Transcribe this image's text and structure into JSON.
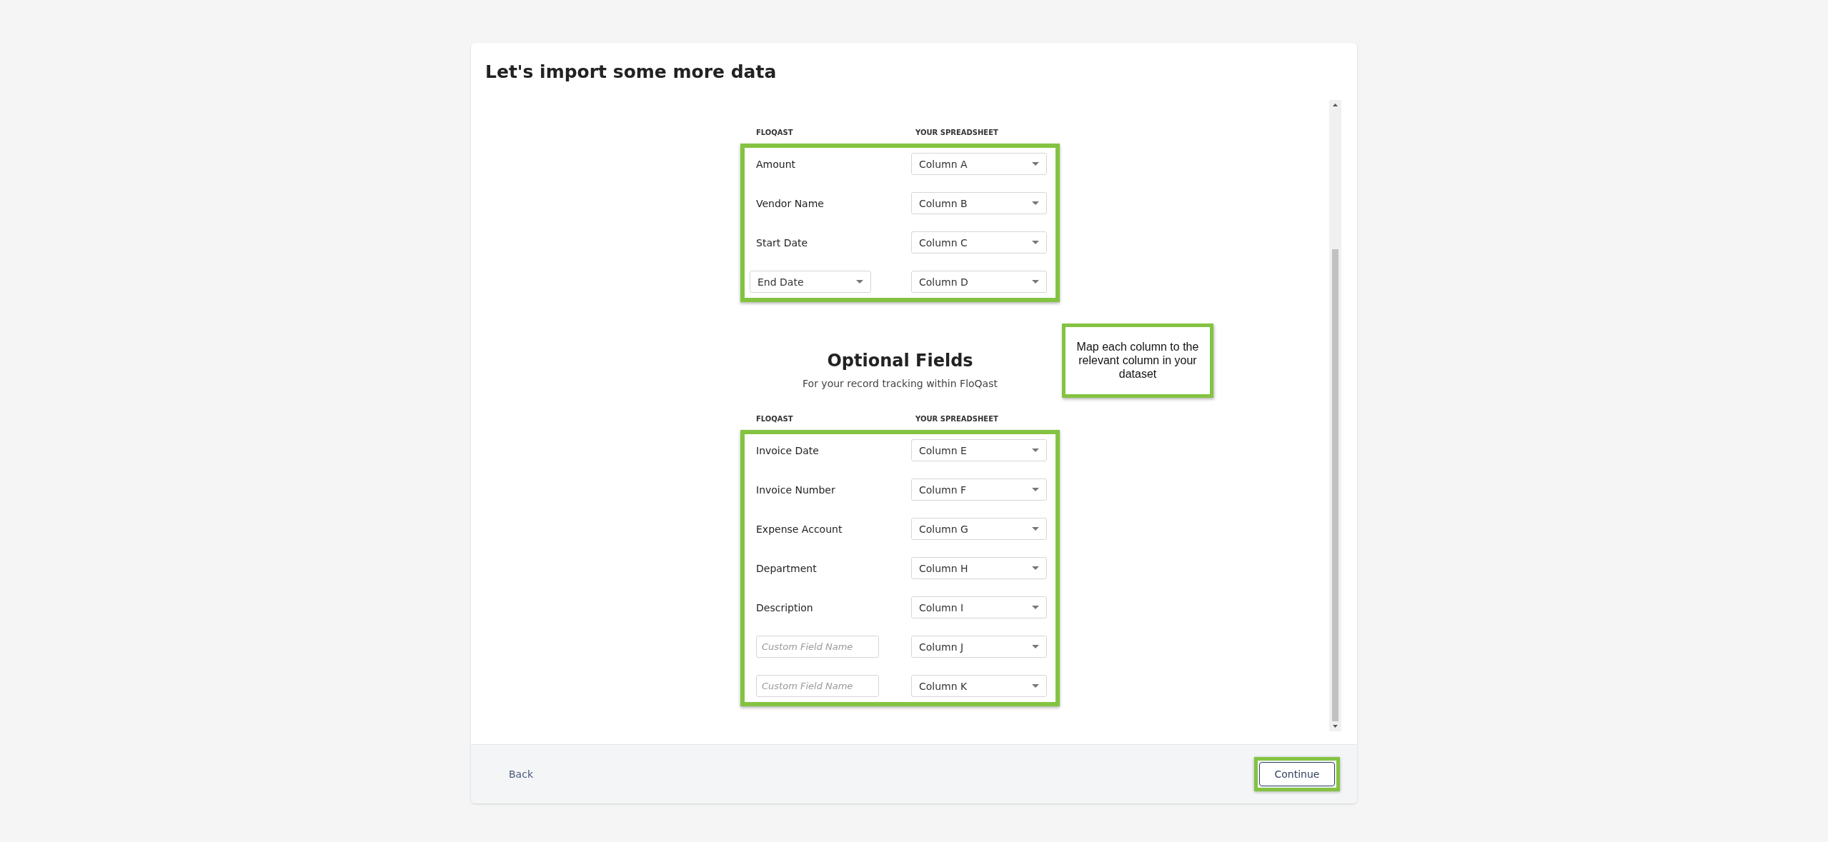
{
  "title": "Let's import some more data",
  "required": {
    "highlighted": true,
    "headers": [
      "FLOQAST",
      "YOUR SPREADSHEET"
    ],
    "rows": [
      {
        "field": {
          "kind": "label",
          "text": "Amount"
        },
        "column": "Column A"
      },
      {
        "field": {
          "kind": "label",
          "text": "Vendor Name"
        },
        "column": "Column B"
      },
      {
        "field": {
          "kind": "label",
          "text": "Start Date"
        },
        "column": "Column C"
      },
      {
        "field": {
          "kind": "select",
          "text": "End Date"
        },
        "column": "Column D"
      }
    ]
  },
  "optional": {
    "title": "Optional Fields",
    "subtitle": "For your record tracking within FloQast",
    "highlighted": true,
    "headers": [
      "FLOQAST",
      "YOUR SPREADSHEET"
    ],
    "rows": [
      {
        "field": {
          "kind": "label",
          "text": "Invoice Date"
        },
        "column": "Column E"
      },
      {
        "field": {
          "kind": "label",
          "text": "Invoice Number"
        },
        "column": "Column F"
      },
      {
        "field": {
          "kind": "label",
          "text": "Expense Account"
        },
        "column": "Column G"
      },
      {
        "field": {
          "kind": "label",
          "text": "Department"
        },
        "column": "Column H"
      },
      {
        "field": {
          "kind": "label",
          "text": "Description"
        },
        "column": "Column I"
      },
      {
        "field": {
          "kind": "input",
          "placeholder": "Custom Field Name"
        },
        "column": "Column J"
      },
      {
        "field": {
          "kind": "input",
          "placeholder": "Custom Field Name"
        },
        "column": "Column K"
      }
    ]
  },
  "callout": {
    "text": "Map each column to the relevant column in your dataset"
  },
  "footer": {
    "back": "Back",
    "continue": {
      "label": "Continue",
      "highlighted": true
    }
  }
}
